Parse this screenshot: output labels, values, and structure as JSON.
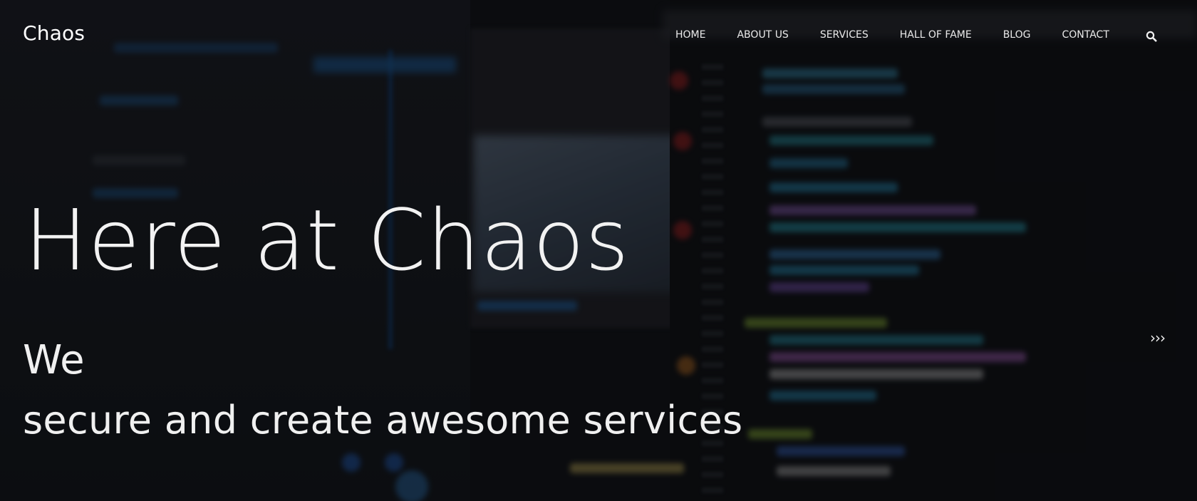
{
  "header": {
    "brand": "Chaos",
    "nav": [
      {
        "label": "HOME"
      },
      {
        "label": "ABOUT US"
      },
      {
        "label": "SERVICES"
      },
      {
        "label": "HALL OF FAME"
      },
      {
        "label": "BLOG"
      },
      {
        "label": "CONTACT"
      }
    ],
    "search_icon": "search-icon"
  },
  "hero": {
    "title": "Here at Chaos",
    "line1": "We",
    "line2": "secure and create awesome services",
    "next_arrow": "›››"
  },
  "colors": {
    "text": "#f0f0f0",
    "background": "#0d0f13"
  }
}
